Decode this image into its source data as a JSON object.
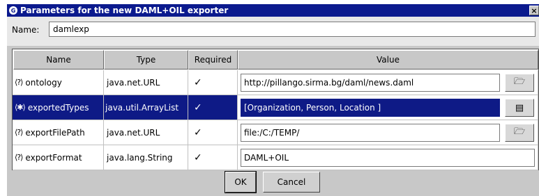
{
  "window": {
    "title": "Parameters for the new DAML+OIL exporter",
    "close_label": "×"
  },
  "name_row": {
    "label": "Name:",
    "value": "damlexp"
  },
  "table": {
    "headers": [
      "Name",
      "Type",
      "Required",
      "Value"
    ],
    "rows": [
      {
        "name": "ontology",
        "type": "java.net.URL",
        "required": "✓",
        "value": "http://pillango.sirma.bg/daml/news.daml",
        "button_icon": "folder-icon",
        "button_glyph": "🗁"
      },
      {
        "name": "exportedTypes",
        "type": "java.util.ArrayList",
        "required": "✓",
        "value": "[Organization, Person, Location ]",
        "button_icon": "list-icon",
        "button_glyph": "▤"
      },
      {
        "name": "exportFilePath",
        "type": "java.net.URL",
        "required": "✓",
        "value": "file:/C:/TEMP/",
        "button_icon": "folder-icon",
        "button_glyph": "🗁"
      },
      {
        "name": "exportFormat",
        "type": "java.lang.String",
        "required": "✓",
        "value": "DAML+OIL"
      }
    ],
    "help_glyph": "⟨?⟩",
    "selected_help_glyph": "⟨✱⟩",
    "selected_row": 1
  },
  "buttons": {
    "ok": "OK",
    "cancel": "Cancel"
  },
  "colors": {
    "title_bg": "#0b1a8e",
    "selection_bg": "#0e1a86",
    "dialog_bg": "#c8c8c8"
  }
}
